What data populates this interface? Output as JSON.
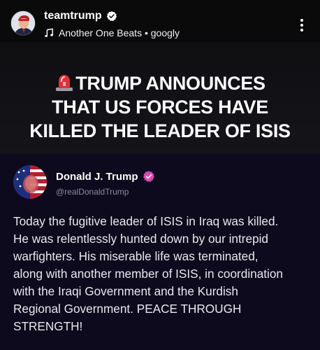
{
  "reel": {
    "username": "teamtrump",
    "audio": "Another One Beats • googly",
    "headline_lines": [
      "TRUMP ANNOUNCES",
      "THAT US FORCES HAVE",
      "KILLED THE LEADER OF ISIS"
    ]
  },
  "post": {
    "name": "Donald J. Trump",
    "handle": "@realDonaldTrump",
    "body_lines": [
      "Today the fugitive leader of ISIS in Iraq was killed.",
      "He was relentlessly hunted down by our intrepid",
      "warfighters. His miserable life was terminated,",
      "along with another member of ISIS, in coordination",
      "with the Iraqi Government and the Kurdish",
      "Regional Government. PEACE THROUGH",
      "STRENGTH!"
    ]
  },
  "colors": {
    "background": "#0c0a1c",
    "verified_blue": "#ffffff",
    "post_badge": "#d64bb0",
    "siren_red": "#e0303a"
  },
  "icons": {
    "verified": "verified-badge-icon",
    "music": "music-note-icon",
    "more": "more-vertical-icon",
    "siren": "siren-emoji-icon"
  }
}
